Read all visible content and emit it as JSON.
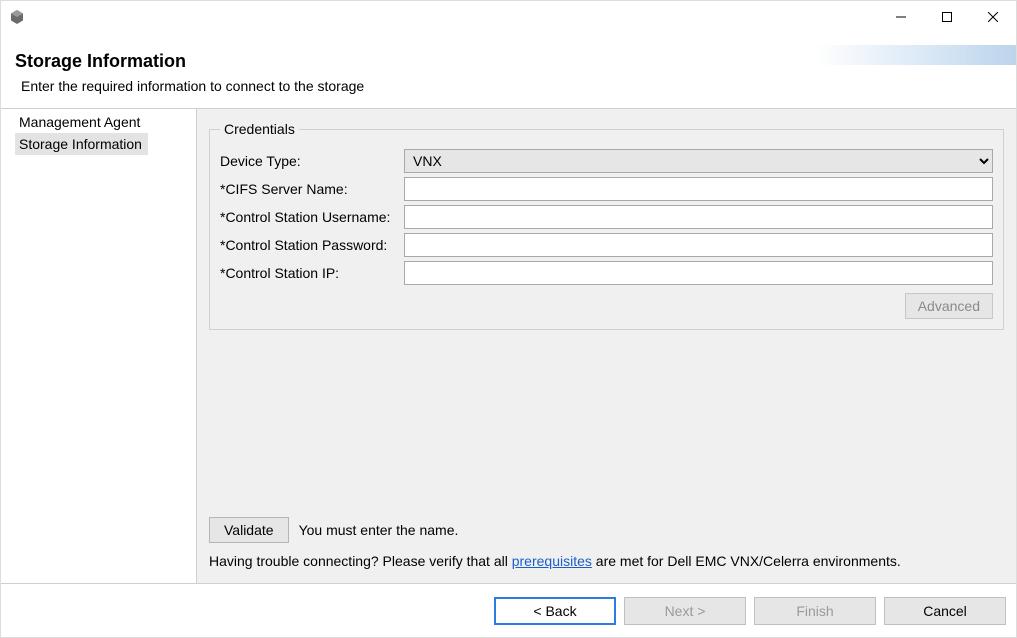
{
  "window": {
    "icon": "app-icon"
  },
  "header": {
    "title": "Storage Information",
    "subtitle": "Enter the required information to connect to the storage"
  },
  "sidebar": {
    "items": [
      {
        "label": "Management Agent",
        "selected": false
      },
      {
        "label": "Storage Information",
        "selected": true
      }
    ]
  },
  "credentials": {
    "legend": "Credentials",
    "device_type_label": "Device Type:",
    "device_type_value": "VNX",
    "cifs_label": "*CIFS Server Name:",
    "cifs_value": "",
    "cs_user_label": "*Control Station Username:",
    "cs_user_value": "",
    "cs_pass_label": "*Control Station Password:",
    "cs_pass_value": "",
    "cs_ip_label": "*Control Station IP:",
    "cs_ip_value": "",
    "advanced_label": "Advanced"
  },
  "validate": {
    "button_label": "Validate",
    "message": "You must enter the name."
  },
  "trouble": {
    "prefix": "Having trouble connecting? Please verify that all ",
    "link": "prerequisites",
    "suffix": " are met for Dell EMC VNX/Celerra environments."
  },
  "footer": {
    "back": "< Back",
    "next": "Next >",
    "finish": "Finish",
    "cancel": "Cancel"
  }
}
